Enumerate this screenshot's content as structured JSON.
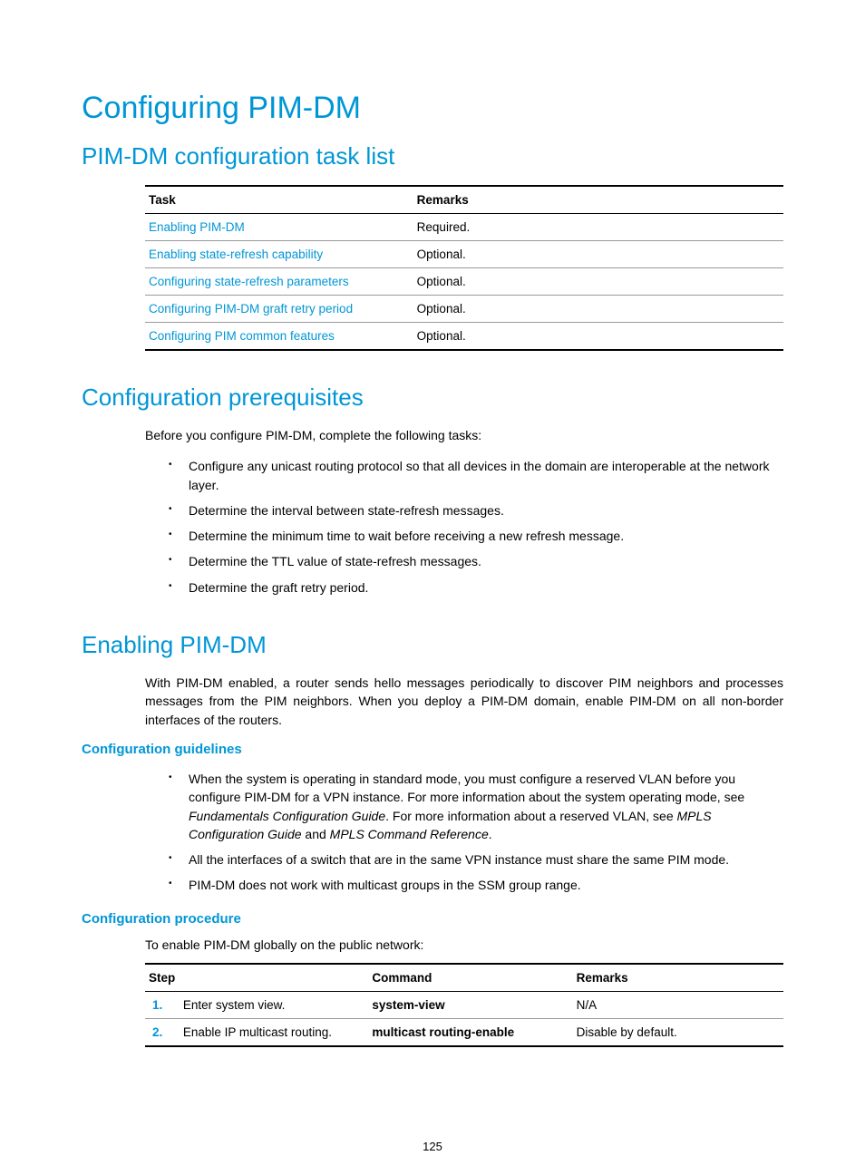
{
  "title": "Configuring PIM-DM",
  "sections": {
    "tasklist": {
      "heading": "PIM-DM configuration task list",
      "headers": {
        "task": "Task",
        "remarks": "Remarks"
      },
      "rows": [
        {
          "task": "Enabling PIM-DM",
          "remarks": "Required."
        },
        {
          "task": "Enabling state-refresh capability",
          "remarks": "Optional."
        },
        {
          "task": "Configuring state-refresh parameters",
          "remarks": "Optional."
        },
        {
          "task": "Configuring PIM-DM graft retry period",
          "remarks": "Optional."
        },
        {
          "task": "Configuring PIM common features",
          "remarks": "Optional."
        }
      ]
    },
    "prereq": {
      "heading": "Configuration prerequisites",
      "intro": "Before you configure PIM-DM, complete the following tasks:",
      "bullets": [
        "Configure any unicast routing protocol so that all devices in the domain are interoperable at the network layer.",
        "Determine the interval between state-refresh messages.",
        "Determine the minimum time to wait before receiving a new refresh message.",
        "Determine the TTL value of state-refresh messages.",
        "Determine the graft retry period."
      ]
    },
    "enabling": {
      "heading": "Enabling PIM-DM",
      "body": "With PIM-DM enabled, a router sends hello messages periodically to discover PIM neighbors and processes messages from the PIM neighbors. When you deploy a PIM-DM domain, enable PIM-DM on all non-border interfaces of the routers.",
      "guidelines": {
        "heading": "Configuration guidelines",
        "bullets_plain": {
          "b0_a": "When the system is operating in standard mode, you must configure a reserved VLAN before you configure PIM-DM for a VPN instance. For more information about the system operating mode, see ",
          "b0_i1": "Fundamentals Configuration Guide",
          "b0_b": ". For more information about a reserved VLAN, see ",
          "b0_i2": "MPLS Configuration Guide",
          "b0_c": " and ",
          "b0_i3": "MPLS Command Reference",
          "b0_d": ".",
          "b1": "All the interfaces of a switch that are in the same VPN instance must share the same PIM mode.",
          "b2": "PIM-DM does not work with multicast groups in the SSM group range."
        }
      },
      "procedure": {
        "heading": "Configuration procedure",
        "intro": "To enable PIM-DM globally on the public network:",
        "headers": {
          "step": "Step",
          "command": "Command",
          "remarks": "Remarks"
        },
        "rows": [
          {
            "num": "1.",
            "step": "Enter system view.",
            "cmd": "system-view",
            "remarks": "N/A"
          },
          {
            "num": "2.",
            "step": "Enable IP multicast routing.",
            "cmd": "multicast routing-enable",
            "remarks": "Disable by default."
          }
        ]
      }
    }
  },
  "page_number": "125"
}
